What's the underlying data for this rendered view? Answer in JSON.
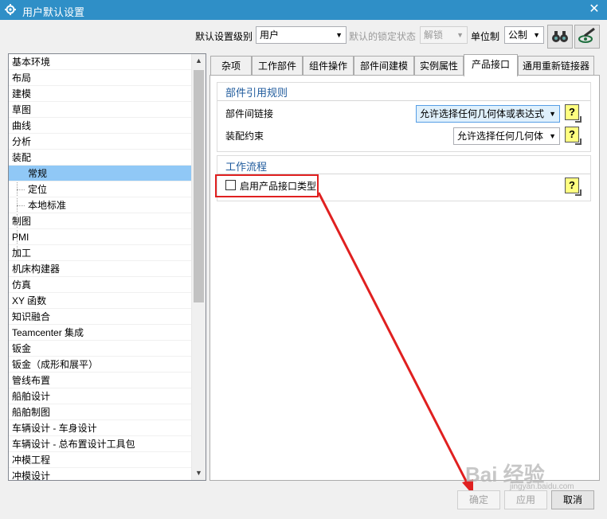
{
  "window": {
    "title": "用户默认设置",
    "close_glyph": "✕"
  },
  "toolbar": {
    "level_label": "默认设置级别",
    "level_value": "用户",
    "lock_label": "默认的锁定状态",
    "lock_value": "解锁",
    "unit_label": "单位制",
    "unit_value": "公制"
  },
  "tree": {
    "items": [
      "基本环境",
      "布局",
      "建模",
      "草图",
      "曲线",
      "分析",
      "装配",
      "常规",
      "定位",
      "本地标准",
      "制图",
      "PMI",
      "加工",
      "机床构建器",
      "仿真",
      "XY 函数",
      "知识融合",
      "Teamcenter 集成",
      "钣金",
      "钣金（成形和展平）",
      "管线布置",
      "船舶设计",
      "船舶制图",
      "车辆设计 - 车身设计",
      "车辆设计 - 总布置设计工具包",
      "冲模工程",
      "冲模设计"
    ],
    "selected": "常规"
  },
  "tabs": [
    "杂项",
    "工作部件",
    "组件操作",
    "部件间建模",
    "实例属性",
    "产品接口",
    "通用重新链接器"
  ],
  "active_tab": "产品接口",
  "groups": {
    "ref_rules": {
      "title": "部件引用规则",
      "interpart_label": "部件间链接",
      "interpart_value": "允许选择任何几何体或表达式",
      "constraint_label": "装配约束",
      "constraint_value": "允许选择任何几何体"
    },
    "workflow": {
      "title": "工作流程",
      "enable_label": "启用产品接口类型",
      "enable_checked": false
    }
  },
  "help_glyph": "?",
  "buttons": {
    "ok": "确定",
    "apply": "应用",
    "cancel": "取消"
  },
  "watermark": {
    "main": "Bai 经验",
    "sub": "jingyan.baidu.com"
  },
  "colors": {
    "titlebar": "#2f8fc7",
    "selection": "#90c8f6",
    "group_title": "#1e5a9c",
    "annotation": "#e02020"
  }
}
